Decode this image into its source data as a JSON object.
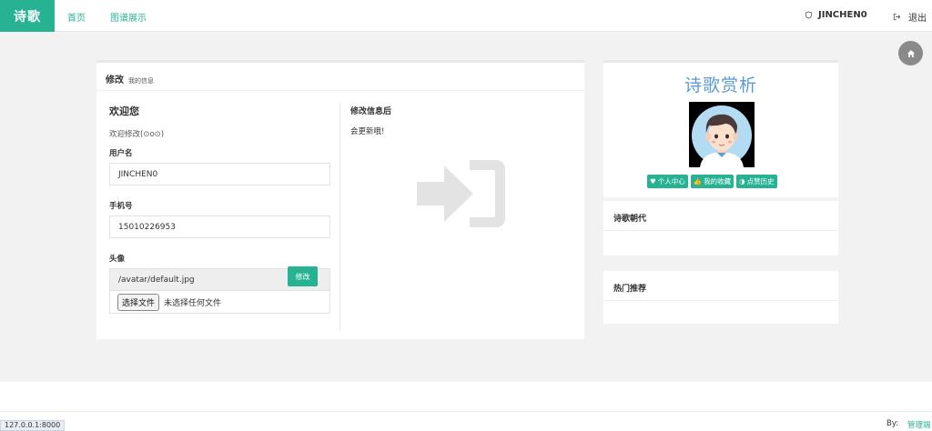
{
  "nav": {
    "brand": "诗歌",
    "links": [
      "首页",
      "图谱展示"
    ],
    "username": "JINCHEN0",
    "logout": "退出"
  },
  "main": {
    "title": "修改",
    "subtitle": "我的信息",
    "welcome": "欢迎您",
    "welcome_sub": "欢迎修改(⊙o⊙)",
    "username_label": "用户名",
    "username_value": "JINCHEN0",
    "phone_label": "手机号",
    "phone_value": "15010226953",
    "avatar_label": "头像",
    "avatar_value": "/avatar/default.jpg",
    "file_button": "选择文件",
    "file_status": "未选择任何文件",
    "submit": "修改",
    "after_title": "修改信息后",
    "after_text": "会更新哦!"
  },
  "side": {
    "title": "诗歌赏析",
    "tags": [
      "个人中心",
      "我的收藏",
      "点赞历史"
    ],
    "dynasty": "诗歌朝代",
    "hot": "热门推荐"
  },
  "footer": {
    "url": "127.0.0.1:8000",
    "by": "By:",
    "admin": "管理端"
  },
  "colors": {
    "accent": "#27b393",
    "title_blue": "#5b9bd5"
  }
}
